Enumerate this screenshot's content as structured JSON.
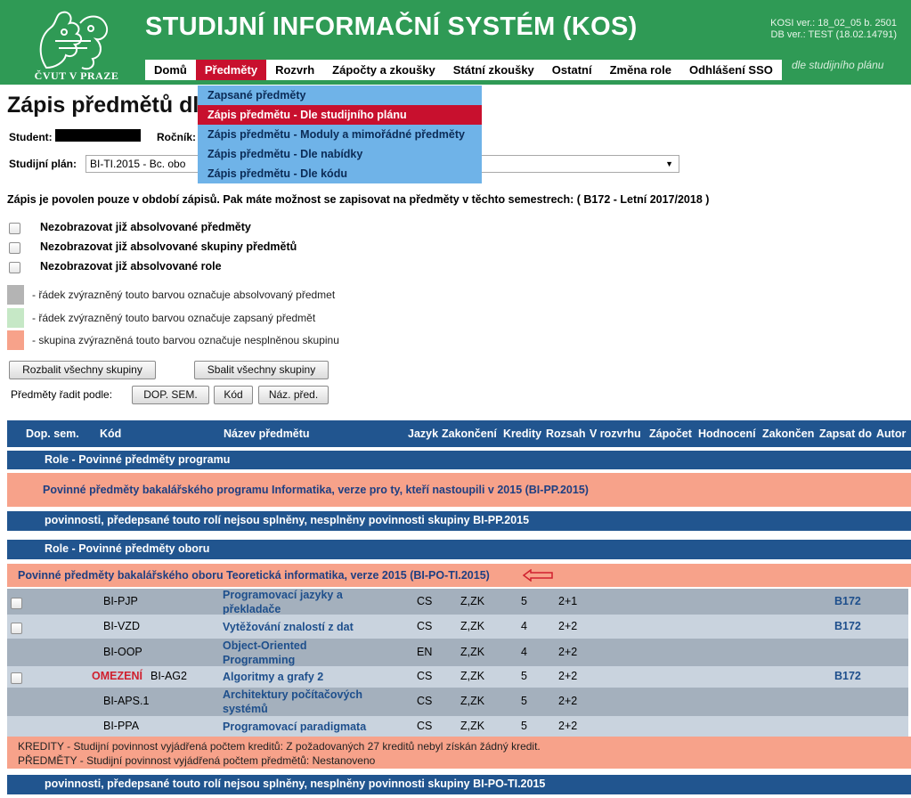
{
  "header": {
    "logo_text": "ČVUT V PRAZE",
    "title": "STUDIJNÍ INFORMAČNÍ SYSTÉM (KOS)",
    "version_line1": "KOSI ver.: 18_02_05 b. 2501",
    "version_line2": "DB ver.: TEST (18.02.14791)",
    "subnav_hint": "dle studijního plánu",
    "accent": "#2f9a55",
    "active_color": "#c8102e"
  },
  "nav": [
    "Domů",
    "Předměty",
    "Rozvrh",
    "Zápočty a zkoušky",
    "Státní zkoušky",
    "Ostatní",
    "Změna role",
    "Odhlášení SSO"
  ],
  "dropdown": [
    "Zapsané předměty",
    "Zápis předmětu - Dle studijního plánu",
    "Zápis předmětu - Moduly a mimořádné předměty",
    "Zápis předmětu - Dle nabídky",
    "Zápis předmětu - Dle kódu"
  ],
  "page": {
    "title": "Zápis předmětů dle",
    "student_label": "Student:",
    "year_label": "Ročník:",
    "plan_label": "Studijní plán:",
    "plan_value": "BI-TI.2015 - Bc. obo",
    "notice": "Zápis je povolen pouze v období zápisů. Pak máte možnost se zapisovat na předměty v těchto semestrech: ( B172 - Letní 2017/2018 )"
  },
  "filters": [
    "Nezobrazovat již absolvované předměty",
    "Nezobrazovat již absolvované skupiny předmětů",
    "Nezobrazovat již absolvované role"
  ],
  "legend": [
    {
      "color": "#b4b4b4",
      "text": "- řádek zvýrazněný touto barvou označuje absolvovaný předmet"
    },
    {
      "color": "#c6e8c6",
      "text": "- řádek zvýrazněný touto barvou označuje zapsaný předmět"
    },
    {
      "color": "#f7a28a",
      "text": "- skupina zvýrazněná touto barvou označuje nesplněnou skupinu"
    }
  ],
  "buttons": {
    "expand_all": "Rozbalit všechny skupiny",
    "collapse_all": "Sbalit všechny skupiny",
    "sort_label": "Předměty řadit podle:",
    "sort_sem": "DOP. SEM.",
    "sort_code": "Kód",
    "sort_name": "Náz. před."
  },
  "table": {
    "headers": [
      "Dop. sem.",
      "Kód",
      "Název předmětu",
      "Jazyk",
      "Zakončení",
      "Kredity",
      "Rozsah",
      "V rozvrhu",
      "Zápočet",
      "Hodnocení",
      "Zakončen",
      "Zapsat do",
      "Autor"
    ],
    "role1": "Role - Povinné předměty programu",
    "group1": "Povinné předměty bakalářského programu Informatika, verze pro ty, kteří nastoupili v 2015 (BI-PP.2015)",
    "footer1": "povinnosti, předepsané touto rolí nejsou splněny, nesplněny povinnosti skupiny BI-PP.2015",
    "role2": "Role - Povinné předměty oboru",
    "group2": "Povinné předměty bakalářského oboru Teoretická informatika, verze 2015 (BI-PO-TI.2015)",
    "rows": [
      {
        "checkbox": true,
        "restriction": "",
        "code": "BI-PJP",
        "name1": "Programovací jazyky a",
        "name2": "překladače",
        "lang": "CS",
        "end": "Z,ZK",
        "credits": "5",
        "range": "2+1",
        "sem": "B172"
      },
      {
        "checkbox": true,
        "restriction": "",
        "code": "BI-VZD",
        "name1": "Vytěžování znalostí z dat",
        "name2": "",
        "lang": "CS",
        "end": "Z,ZK",
        "credits": "4",
        "range": "2+2",
        "sem": "B172"
      },
      {
        "checkbox": false,
        "restriction": "",
        "code": "BI-OOP",
        "name1": "Object-Oriented",
        "name2": "Programming",
        "lang": "EN",
        "end": "Z,ZK",
        "credits": "4",
        "range": "2+2",
        "sem": ""
      },
      {
        "checkbox": true,
        "restriction": "OMEZENÍ",
        "code": "BI-AG2",
        "name1": "Algoritmy a grafy 2",
        "name2": "",
        "lang": "CS",
        "end": "Z,ZK",
        "credits": "5",
        "range": "2+2",
        "sem": "B172"
      },
      {
        "checkbox": false,
        "restriction": "",
        "code": "BI-APS.1",
        "name1": "Architektury počítačových",
        "name2": "systémů",
        "lang": "CS",
        "end": "Z,ZK",
        "credits": "5",
        "range": "2+2",
        "sem": ""
      },
      {
        "checkbox": false,
        "restriction": "",
        "code": "BI-PPA",
        "name1": "Programovací paradigmata",
        "name2": "",
        "lang": "CS",
        "end": "Z,ZK",
        "credits": "5",
        "range": "2+2",
        "sem": ""
      }
    ],
    "info1": "KREDITY - Studijní povinnost vyjádřená počtem kreditů: Z požadovaných 27 kreditů nebyl získán žádný kredit.",
    "info2": "PŘEDMĚTY - Studijní povinnost vyjádřená počtem předmětů: Nestanoveno",
    "footer2": "povinnosti, předepsané touto rolí nejsou splněny, nesplněny povinnosti skupiny BI-PO-TI.2015"
  }
}
